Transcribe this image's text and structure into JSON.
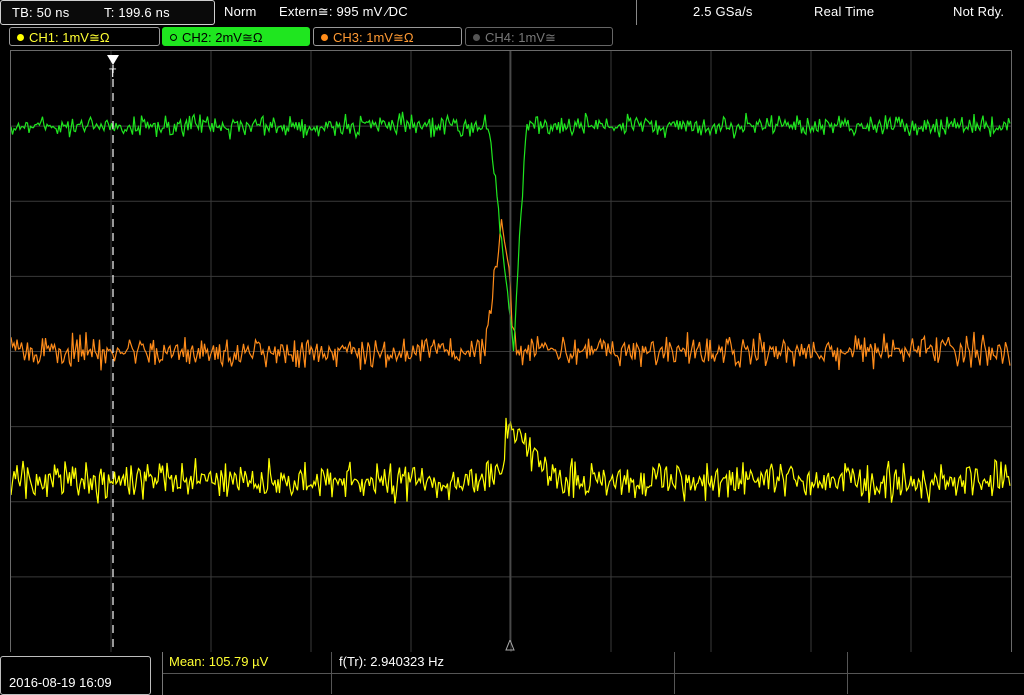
{
  "status": {
    "timebase": "TB: 50 ns",
    "trigger_time": "T: 199.6 ns",
    "acq_mode": "Norm",
    "trigger": "Extern≅: 995 mV ⁄DC",
    "sample_rate": "2.5 GSa/s",
    "real_time": "Real Time",
    "state": "Not Rdy."
  },
  "channels": [
    {
      "label": "CH1: 1mV≅Ω",
      "color": "#ffff00"
    },
    {
      "label": "CH2: 2mV≅Ω",
      "color": "#1fe61f"
    },
    {
      "label": "CH3: 1mV≅Ω",
      "color": "#ff8c1a"
    },
    {
      "label": "CH4: 1mV≅",
      "color": "#777777"
    }
  ],
  "measurements": {
    "mean": "Mean: 105.79 µV",
    "frequency": "f(Tr): 2.940323 Hz"
  },
  "datetime": "2016-08-19 16:09",
  "icons": {
    "trigger_position": "trigger-position-marker-icon",
    "trigger_level": "trigger-level-arrow-icon"
  }
}
